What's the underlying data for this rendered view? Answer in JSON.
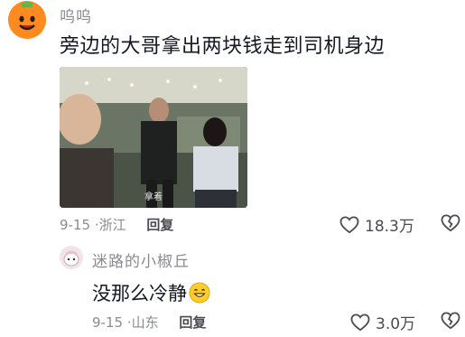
{
  "comments": [
    {
      "username": "呜呜",
      "text": "旁边的大哥拿出两块钱走到司机身边",
      "image_caption": "拿着",
      "date": "9-15",
      "location": "浙江",
      "reply_label": "回复",
      "likes": "18.3万"
    },
    {
      "username": "迷路的小椒丘",
      "text": "没那么冷静",
      "emoji": "smiling-emoji",
      "date": "9-15",
      "location": "山东",
      "reply_label": "回复",
      "likes": "3.0万"
    }
  ],
  "icons": {
    "like": "heart-outline-icon",
    "dislike": "broken-heart-icon"
  },
  "colors": {
    "primary_text": "#161823",
    "secondary_text": "#8a8b91",
    "action_text": "#4a4b52",
    "avatar1": "#ff8a1f"
  }
}
